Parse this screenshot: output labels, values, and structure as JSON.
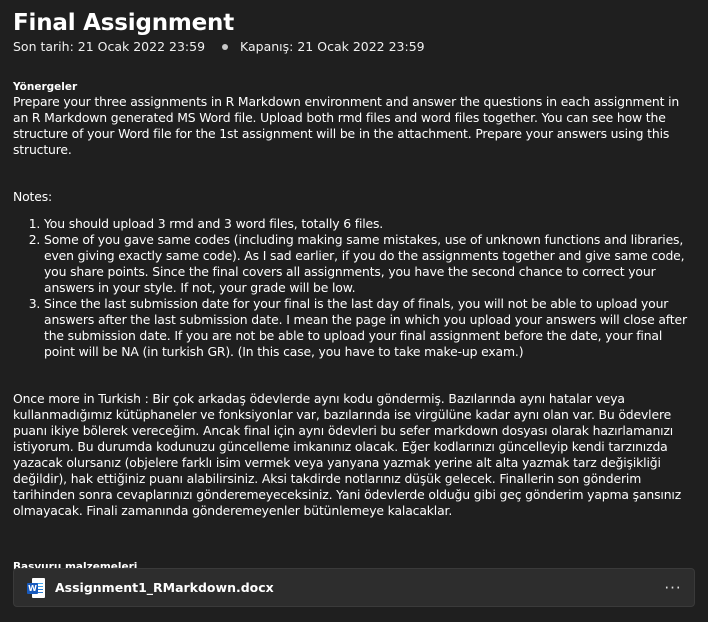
{
  "assignment": {
    "title": "Final Assignment",
    "due_label": "Son tarih: 21 Ocak 2022 23:59",
    "close_label": "Kapanış: 21 Ocak 2022 23:59"
  },
  "instructions": {
    "label": "Yönergeler",
    "intro": "Prepare your three assignments in R Markdown environment and answer the questions in each assignment in an R Markdown generated MS Word file. Upload both rmd files and word files together. You can see how the structure of your Word file for the 1st assignment will be in the attachment. Prepare your answers using this structure.",
    "notes_title": "Notes:",
    "notes": [
      "You should upload 3 rmd and 3 word files, totally 6 files.",
      "Some of you gave same codes (including making same mistakes, use of unknown functions and libraries, even giving exactly same code). As I sad earlier, if you do the assignments together and give same code, you share points. Since the final covers all assignments, you have the second chance to correct your answers in your style. If not, your grade will be low.",
      "Since the last submission date for your final is the last day of finals, you will not be able to upload your answers after the last submission date. I mean the page in which you upload your answers will close after the submission date. If you are not be able to upload your final assignment before the date, your final point will be NA (in turkish GR). (In this case, you have to take make-up exam.)"
    ],
    "turkish": "Once more in Turkish : Bir çok arkadaş ödevlerde aynı kodu göndermiş. Bazılarında aynı hatalar veya kullanmadığımız kütüphaneler ve fonksiyonlar var, bazılarında ise virgülüne kadar aynı olan var. Bu ödevlere puanı ikiye bölerek vereceğim. Ancak final için aynı ödevleri bu sefer markdown dosyası olarak hazırlamanızı istiyorum. Bu durumda kodunuzu güncelleme imkanınız olacak. Eğer kodlarınızı güncelleyip kendi tarzınızda yazacak olursanız (objelere farklı isim vermek veya yanyana yazmak yerine alt alta yazmak tarz değişikliği değildir), hak ettiğiniz puanı alabilirsiniz. Aksi takdirde notlarınız düşük gelecek. Finallerin son gönderim tarihinden sonra cevaplarınızı gönderemeyeceksiniz. Yani ödevlerde olduğu gibi geç gönderim yapma şansınız olmayacak. Finali zamanında gönderemeyenler bütünlemeye kalacaklar."
  },
  "reference": {
    "label": "Başvuru malzemeleri",
    "file_name": "Assignment1_RMarkdown.docx",
    "file_icon": "word-document-icon",
    "more_icon": "more-options-icon",
    "more_glyph": "···",
    "badge_letter": "W"
  },
  "colors": {
    "background": "#1f1f1f",
    "attachment_bg": "#2d2d2d",
    "word_blue": "#185abd"
  }
}
